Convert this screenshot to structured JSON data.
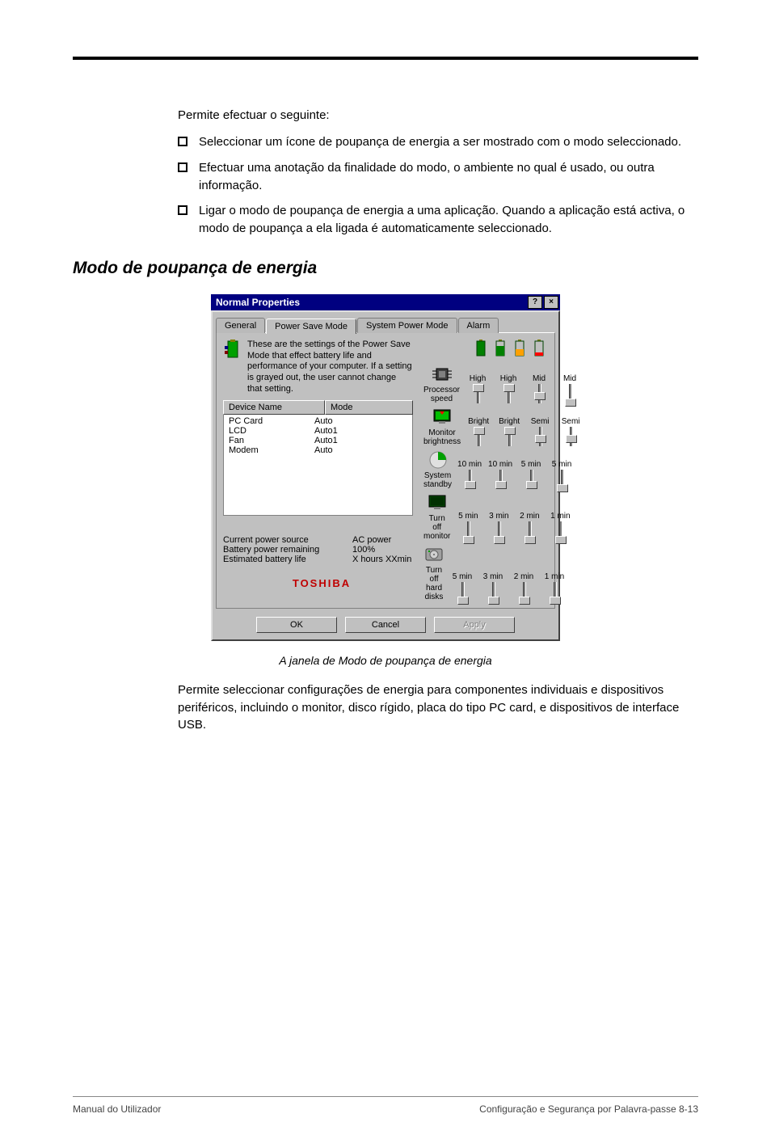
{
  "intro": "Permite efectuar o seguinte:",
  "bullets": [
    "Seleccionar um ícone de poupança de energia a ser mostrado com o modo seleccionado.",
    "Efectuar uma anotação da finalidade do modo, o ambiente no qual é usado, ou outra informação.",
    "Ligar o modo de poupança de energia a uma aplicação. Quando a aplicação está activa, o modo de poupança a ela ligada é automaticamente seleccionado."
  ],
  "section_title": "Modo de poupança de energia",
  "caption": "A janela de Modo de poupança de energia",
  "after": "Permite seleccionar configurações de energia para componentes individuais e dispositivos periféricos, incluindo o monitor, disco rígido, placa do tipo PC card, e dispositivos de interface USB.",
  "footer": {
    "left": "Manual do Utilizador",
    "right": "Configuração e Segurança por Palavra-passe  8-13"
  },
  "dialog": {
    "title": "Normal Properties",
    "help_btn": "?",
    "close_btn": "×",
    "tabs": [
      "General",
      "Power Save Mode",
      "System Power Mode",
      "Alarm"
    ],
    "active_tab": 1,
    "description": "These are the settings of the Power Save Mode that effect battery life and performance of your computer. If a setting is grayed out, the user cannot change that setting.",
    "device_table": {
      "headers": [
        "Device Name",
        "Mode"
      ],
      "rows": [
        [
          "PC Card",
          "Auto"
        ],
        [
          "LCD",
          "Auto1"
        ],
        [
          "Fan",
          "Auto1"
        ],
        [
          "Modem",
          "Auto"
        ]
      ]
    },
    "power_info": {
      "rows": [
        [
          "Current power source",
          "AC power"
        ],
        [
          "Battery power remaining",
          "100%"
        ],
        [
          "Estimated battery life",
          "X hours XXmin"
        ]
      ]
    },
    "brand": "TOSHIBA",
    "settings": [
      {
        "name": "Processor speed",
        "icon": "cpu",
        "values": [
          "High",
          "High",
          "Mid",
          "Mid"
        ],
        "thumb": [
          0,
          0,
          10,
          18
        ]
      },
      {
        "name": "Monitor brightness",
        "icon": "monitor",
        "values": [
          "Bright",
          "Bright",
          "Semi",
          "Semi"
        ],
        "thumb": [
          0,
          0,
          10,
          10
        ]
      },
      {
        "name": "System standby",
        "icon": "standby",
        "values": [
          "10 min",
          "10 min",
          "5 min",
          "5 min"
        ],
        "thumb": [
          14,
          14,
          14,
          18
        ]
      },
      {
        "name": "Turn off monitor",
        "icon": "mon-off",
        "values": [
          "5 min",
          "3 min",
          "2 min",
          "1 min"
        ],
        "thumb": [
          18,
          18,
          18,
          18
        ]
      },
      {
        "name": "Turn off hard disks",
        "icon": "hdd",
        "values": [
          "5 min",
          "3 min",
          "2 min",
          "1 min"
        ],
        "thumb": [
          18,
          18,
          18,
          18
        ]
      }
    ],
    "buttons": {
      "ok": "OK",
      "cancel": "Cancel",
      "apply": "Apply"
    }
  }
}
